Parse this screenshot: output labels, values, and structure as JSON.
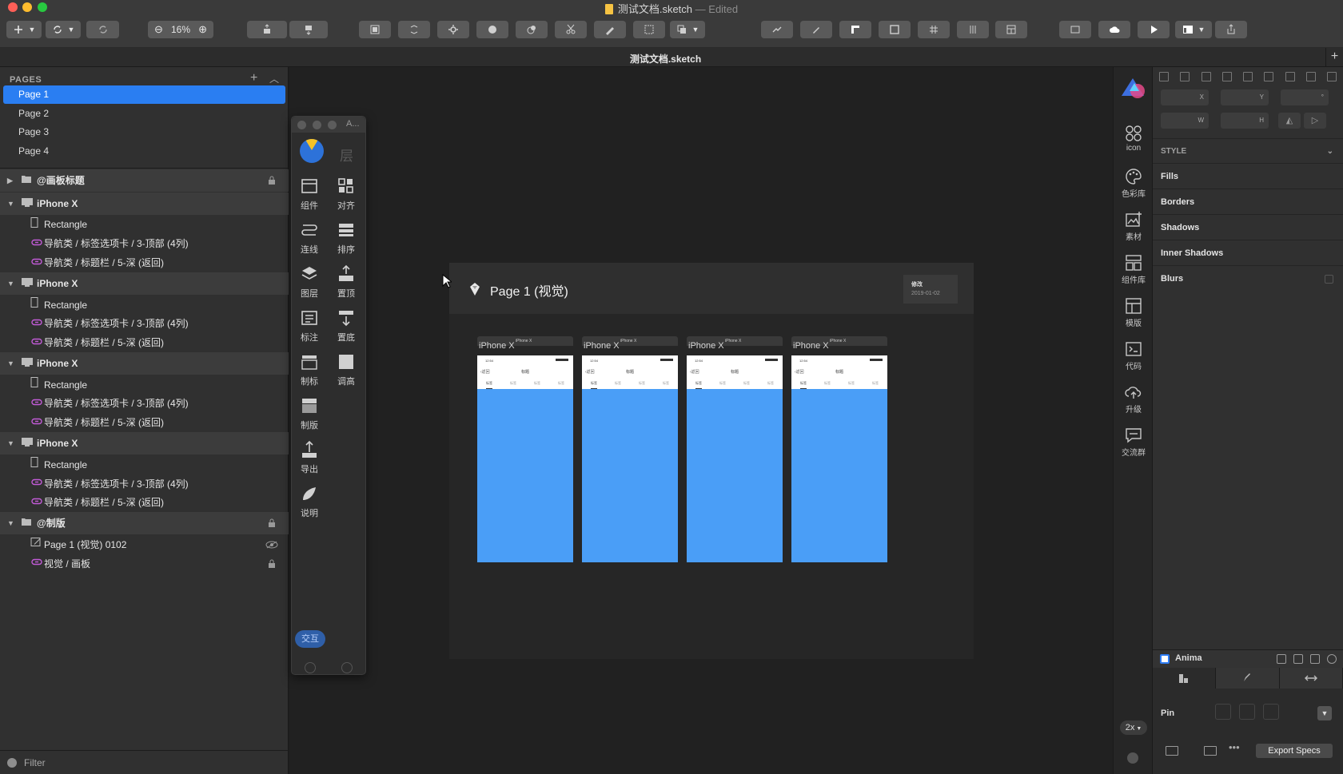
{
  "window": {
    "title": "测试文档.sketch",
    "edited": "— Edited",
    "tab_title": "测试文档.sketch",
    "zoom": "16%"
  },
  "pages_panel": {
    "header": "PAGES",
    "pages": [
      "Page 1",
      "Page 2",
      "Page 3",
      "Page 4"
    ],
    "active_page": "Page 1"
  },
  "layers": [
    {
      "kind": "group",
      "icon": "folder-icon",
      "label": "@画板标题",
      "locked": true,
      "expanded": false
    },
    {
      "kind": "group",
      "icon": "artboard-icon",
      "label": "iPhone X",
      "expanded": true
    },
    {
      "kind": "child",
      "icon": "rectangle-icon",
      "label": "Rectangle"
    },
    {
      "kind": "child",
      "icon": "symbol-icon",
      "label": "导航类 / 标签选项卡 / 3-顶部 (4列)"
    },
    {
      "kind": "child",
      "icon": "symbol-icon",
      "label": "导航类 / 标题栏 / 5-深 (返回)"
    },
    {
      "kind": "group",
      "icon": "artboard-icon",
      "label": "iPhone X",
      "expanded": true
    },
    {
      "kind": "child",
      "icon": "rectangle-icon",
      "label": "Rectangle"
    },
    {
      "kind": "child",
      "icon": "symbol-icon",
      "label": "导航类 / 标签选项卡 / 3-顶部 (4列)"
    },
    {
      "kind": "child",
      "icon": "symbol-icon",
      "label": "导航类 / 标题栏 / 5-深 (返回)"
    },
    {
      "kind": "group",
      "icon": "artboard-icon",
      "label": "iPhone X",
      "expanded": true
    },
    {
      "kind": "child",
      "icon": "rectangle-icon",
      "label": "Rectangle"
    },
    {
      "kind": "child",
      "icon": "symbol-icon",
      "label": "导航类 / 标签选项卡 / 3-顶部 (4列)"
    },
    {
      "kind": "child",
      "icon": "symbol-icon",
      "label": "导航类 / 标题栏 / 5-深 (返回)"
    },
    {
      "kind": "group",
      "icon": "artboard-icon",
      "label": "iPhone X",
      "expanded": true
    },
    {
      "kind": "child",
      "icon": "rectangle-icon",
      "label": "Rectangle"
    },
    {
      "kind": "child",
      "icon": "symbol-icon",
      "label": "导航类 / 标签选项卡 / 3-顶部 (4列)"
    },
    {
      "kind": "child",
      "icon": "symbol-icon",
      "label": "导航类 / 标题栏 / 5-深 (返回)"
    },
    {
      "kind": "group",
      "icon": "folder-icon",
      "label": "@制版",
      "locked": true,
      "expanded": true
    },
    {
      "kind": "child",
      "icon": "text-layer-icon",
      "label": "Page 1 (视觉) 0102",
      "hidden": true
    },
    {
      "kind": "child",
      "icon": "symbol-icon",
      "label": "视觉 / 画板",
      "locked": true
    }
  ],
  "filter_label": "Filter",
  "plugin_panel": {
    "title": "A...",
    "layer_glyph": "层",
    "tools": [
      {
        "label": "组件",
        "icon": "component-icon"
      },
      {
        "label": "对齐",
        "icon": "align-icon"
      },
      {
        "label": "连线",
        "icon": "connect-line-icon"
      },
      {
        "label": "排序",
        "icon": "sort-icon"
      },
      {
        "label": "图层",
        "icon": "layers-icon"
      },
      {
        "label": "置顶",
        "icon": "bring-front-icon"
      },
      {
        "label": "标注",
        "icon": "annotate-icon"
      },
      {
        "label": "置底",
        "icon": "send-back-icon"
      },
      {
        "label": "制标",
        "icon": "make-title-icon"
      },
      {
        "label": "调高",
        "icon": "adjust-height-icon"
      },
      {
        "label": "制版",
        "icon": "make-board-icon"
      },
      {
        "label": "导出",
        "icon": "export-icon"
      },
      {
        "label": "说明",
        "icon": "note-icon"
      }
    ],
    "interact_label": "交互"
  },
  "board": {
    "title": "Page 1 (视觉)",
    "date_label": "修改",
    "date": "2019-01-02",
    "phones": [
      {
        "label": "iPhone X",
        "sublabel": "iPhone X",
        "time": "12:54",
        "back": "返回",
        "nav_title": "标题",
        "tabs": [
          "标签",
          "标签",
          "标签",
          "标签"
        ]
      },
      {
        "label": "iPhone X",
        "sublabel": "iPhone X",
        "time": "12:54",
        "back": "返回",
        "nav_title": "标题",
        "tabs": [
          "标签",
          "标签",
          "标签",
          "标签"
        ]
      },
      {
        "label": "iPhone X",
        "sublabel": "iPhone X",
        "time": "12:54",
        "back": "返回",
        "nav_title": "标题",
        "tabs": [
          "标签",
          "标签",
          "标签",
          "标签"
        ]
      },
      {
        "label": "iPhone X",
        "sublabel": "iPhone X",
        "time": "12:54",
        "back": "返回",
        "nav_title": "标题",
        "tabs": [
          "标签",
          "标签",
          "标签",
          "标签"
        ]
      }
    ]
  },
  "icon_column": [
    {
      "label": "icon",
      "icon": "icon-library-icon"
    },
    {
      "label": "色彩库",
      "icon": "palette-icon"
    },
    {
      "label": "素材",
      "icon": "assets-icon"
    },
    {
      "label": "组件库",
      "icon": "component-library-icon"
    },
    {
      "label": "模版",
      "icon": "template-icon"
    },
    {
      "label": "代码",
      "icon": "code-icon"
    },
    {
      "label": "升级",
      "icon": "upgrade-icon"
    },
    {
      "label": "交流群",
      "icon": "chat-icon"
    }
  ],
  "scale": "2x",
  "inspector": {
    "fields": {
      "x": "X",
      "y": "Y",
      "rotation": "°",
      "w": "W",
      "h": "H"
    },
    "style_header": "STYLE",
    "sections": [
      "Fills",
      "Borders",
      "Shadows",
      "Inner Shadows",
      "Blurs"
    ]
  },
  "anima": {
    "title": "Anima",
    "pin_label": "Pin",
    "export_label": "Export Specs"
  },
  "colors": {
    "accent": "#2a7ef2",
    "artboard_fill": "#4a9ef7",
    "symbol_purple": "#c25bd6"
  }
}
